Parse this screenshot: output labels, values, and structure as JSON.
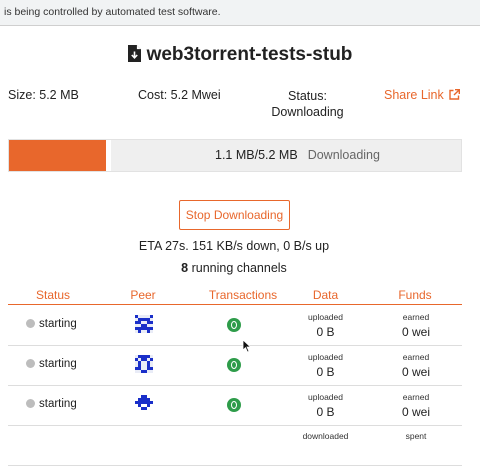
{
  "banner": {
    "text": "is being controlled by automated test software."
  },
  "header": {
    "title": "web3torrent-tests-stub",
    "title_icon": "file-download-icon"
  },
  "info": {
    "size": "Size: 5.2 MB",
    "cost": "Cost: 5.2 Mwei",
    "status_label": "Status:",
    "status_value": "Downloading",
    "share_link": "Share Link",
    "share_icon": "external-link-icon"
  },
  "progress": {
    "fraction": 0.212,
    "amount": "1.1 MB/5.2 MB",
    "state": "Downloading",
    "fill_color": "#e8672c"
  },
  "actions": {
    "stop_label": "Stop Downloading"
  },
  "stats": {
    "eta": "ETA 27s. 151 KB/s down, 0 B/s up",
    "channels_count": "8",
    "channels_suffix": " running channels"
  },
  "table": {
    "headers": {
      "status": "Status",
      "peer": "Peer",
      "transactions": "Transactions",
      "data": "Data",
      "funds": "Funds"
    },
    "rows": [
      {
        "status": "starting",
        "data_label": "uploaded",
        "data_value": "0 B",
        "funds_label": "earned",
        "funds_value": "0 wei"
      },
      {
        "status": "starting",
        "data_label": "uploaded",
        "data_value": "0 B",
        "funds_label": "earned",
        "funds_value": "0 wei"
      },
      {
        "status": "starting",
        "data_label": "uploaded",
        "data_value": "0 B",
        "funds_label": "earned",
        "funds_value": "0 wei"
      },
      {
        "status": "",
        "data_label": "downloaded",
        "data_value": "",
        "funds_label": "spent",
        "funds_value": ""
      }
    ]
  },
  "colors": {
    "accent": "#e8672c",
    "tx_badge": "#2e9c4a",
    "status_dot": "#bdbdbd",
    "peer_avatar": "#1a2fc9"
  }
}
